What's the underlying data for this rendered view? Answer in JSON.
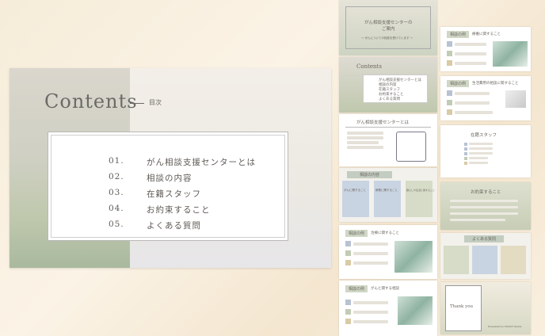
{
  "main": {
    "title": "Contents",
    "subtitle": "目次",
    "items": [
      {
        "num": "01.",
        "label": "がん相談支援センターとは"
      },
      {
        "num": "02.",
        "label": "相談の内容"
      },
      {
        "num": "03.",
        "label": "在籍スタッフ"
      },
      {
        "num": "04.",
        "label": "お約束すること"
      },
      {
        "num": "05.",
        "label": "よくある質問"
      }
    ]
  },
  "thumbs": {
    "cover_title_1": "がん相談支援センターの",
    "cover_title_2": "ご案内",
    "cover_sub": "〜 がんについての相談を受けています 〜",
    "contents_title": "Contents",
    "contents_items": [
      "がん相談支援センターとは",
      "相談の内容",
      "在籍スタッフ",
      "お約束すること",
      "よくある質問"
    ],
    "about_title": "がん相談支援センターとは",
    "consult_title": "相談の内容",
    "consult_cards": [
      "がんに関すること",
      "療養に関すること",
      "暮らしや生活に関すること"
    ],
    "example1": "相談の例",
    "example1_sub": "治療に関すること",
    "example2": "相談の例",
    "example2_sub": "がんと関する相談",
    "example3": "相談の例",
    "example3_sub": "療養に関すること",
    "example4": "相談の例",
    "example4_sub": "生活費用の相談に関すること",
    "staff_title": "在籍スタッフ",
    "promise_title": "お約束すること",
    "faq_title": "よくある質問",
    "thanks": "Thank you",
    "presented_by": "Presented by SODOT Seiwa"
  },
  "colors": {
    "accent_green": "#a9b99e",
    "accent_blue": "#b8c3d2",
    "accent_gold": "#d9cba6"
  }
}
